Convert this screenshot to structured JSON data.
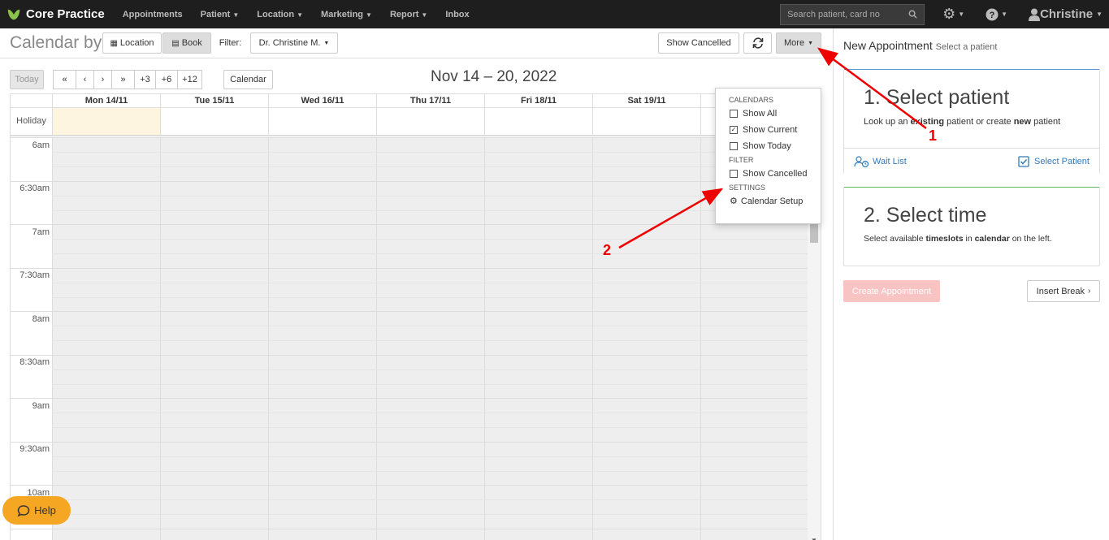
{
  "navbar": {
    "brand": "Core Practice",
    "items": [
      "Appointments",
      "Patient",
      "Location",
      "Marketing",
      "Report",
      "Inbox"
    ],
    "search_placeholder": "Search patient, card no",
    "user": "Christine"
  },
  "toolbar": {
    "title": "Calendar by",
    "location_label": "Location",
    "book_label": "Book",
    "filter_label": "Filter:",
    "filter_value": "Dr. Christine M.",
    "show_cancelled": "Show Cancelled",
    "more_label": "More"
  },
  "navigation": {
    "today": "Today",
    "first": "«",
    "prev": "‹",
    "next": "›",
    "last": "»",
    "plus3": "+3",
    "plus6": "+6",
    "plus12": "+12",
    "calendar": "Calendar"
  },
  "week_title": "Nov 14 – 20, 2022",
  "calendar": {
    "days": [
      "Mon 14/11",
      "Tue 15/11",
      "Wed 16/11",
      "Thu 17/11",
      "Fri 18/11",
      "Sat 19/11",
      ""
    ],
    "holiday_label": "Holiday",
    "times": [
      "6am",
      "6:30am",
      "7am",
      "7:30am",
      "8am",
      "8:30am",
      "9am",
      "9:30am",
      "10am"
    ]
  },
  "dropdown": {
    "calendars_header": "CALENDARS",
    "show_all": "Show All",
    "show_current": "Show Current",
    "show_today": "Show Today",
    "filter_header": "FILTER",
    "show_cancelled": "Show Cancelled",
    "settings_header": "SETTINGS",
    "calendar_setup": "Calendar Setup"
  },
  "right_pane": {
    "heading": "New Appointment",
    "heading_sub": "Select a patient",
    "step1_title": "1. Select patient",
    "step1_text_a": "Look up an ",
    "step1_text_b": "existing",
    "step1_text_c": " patient or create ",
    "step1_text_d": "new",
    "step1_text_e": " patient",
    "wait_list": "Wait List",
    "select_patient": "Select Patient",
    "step2_title": "2. Select time",
    "step2_text_a": "Select available ",
    "step2_text_b": "timeslots",
    "step2_text_c": " in ",
    "step2_text_d": "calendar",
    "step2_text_e": " on the left.",
    "create_appointment": "Create Appointment",
    "insert_break": "Insert Break"
  },
  "help": "Help",
  "annotations": [
    "1",
    "2"
  ],
  "colors": {
    "annotation": "#e00000",
    "navbar": "#1e1e1e",
    "help": "#f5a623",
    "today_column": "#fdf5e0"
  }
}
